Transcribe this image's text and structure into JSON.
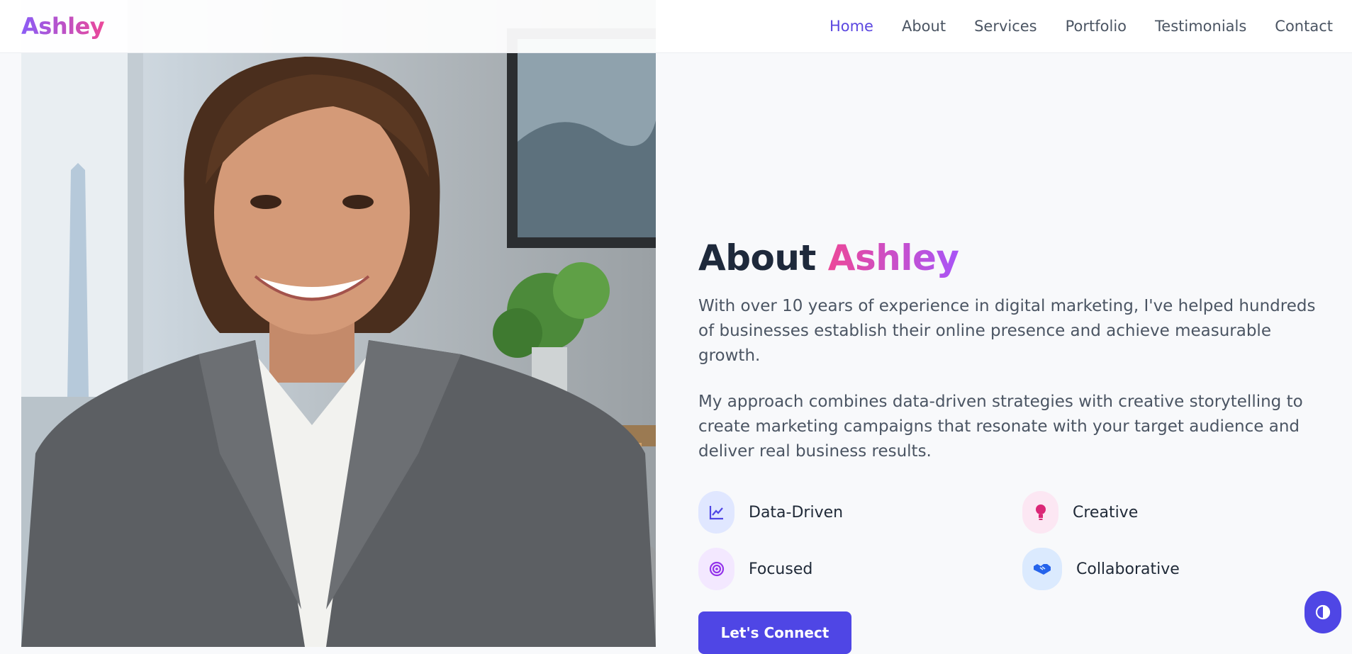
{
  "brand": {
    "name": "Ashley"
  },
  "nav": {
    "items": [
      {
        "label": "Home",
        "active": true
      },
      {
        "label": "About"
      },
      {
        "label": "Services"
      },
      {
        "label": "Portfolio"
      },
      {
        "label": "Testimonials"
      },
      {
        "label": "Contact"
      }
    ]
  },
  "about": {
    "title_prefix": "About",
    "title_accent": "Ashley",
    "paragraphs": [
      "With over 10 years of experience in digital marketing, I've helped hundreds of businesses establish their online presence and achieve measurable growth.",
      "My approach combines data-driven strategies with creative storytelling to create marketing campaigns that resonate with your target audience and deliver real business results."
    ],
    "features": [
      {
        "label": "Data-Driven",
        "icon": "chart-line-icon"
      },
      {
        "label": "Creative",
        "icon": "lightbulb-icon"
      },
      {
        "label": "Focused",
        "icon": "target-icon"
      },
      {
        "label": "Collaborative",
        "icon": "handshake-icon"
      }
    ],
    "cta_label": "Let's Connect"
  },
  "colors": {
    "accent": "#4f46e5",
    "brand_gradient_start": "#8b5cf6",
    "brand_gradient_end": "#ec4899"
  },
  "photo": {
    "subject": "portrait-photo"
  },
  "theme_toggle": {
    "icon": "contrast-icon"
  }
}
